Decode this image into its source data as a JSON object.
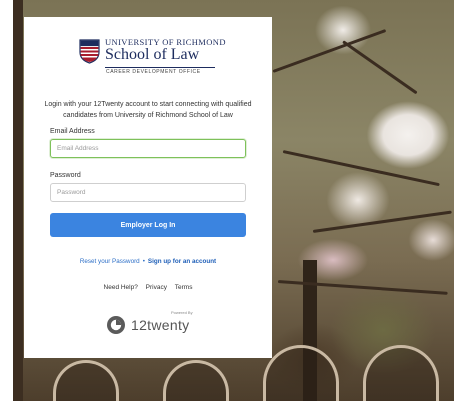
{
  "school": {
    "university": "UNIVERSITY OF RICHMOND",
    "school_name": "School of Law",
    "office": "CAREER DEVELOPMENT OFFICE"
  },
  "intro_text": "Login with your 12Twenty account to start connecting with qualified candidates from University of Richmond School of Law",
  "email": {
    "label": "Email Address",
    "placeholder": "Email Address",
    "value": ""
  },
  "password": {
    "label": "Password",
    "placeholder": "Password",
    "value": ""
  },
  "login_button": "Employer Log In",
  "links": {
    "reset_password": "Reset your Password",
    "separator": "•",
    "signup": "Sign up for an account"
  },
  "footer": {
    "need_help": "Need Help?",
    "privacy": "Privacy",
    "terms": "Terms"
  },
  "powered_by": {
    "label": "Powered By",
    "brand": "12twenty"
  },
  "colors": {
    "primary_button": "#3b84e0",
    "link": "#2d6fc7",
    "focus_border": "#7ec15a",
    "brand_navy": "#1d2c5e"
  }
}
